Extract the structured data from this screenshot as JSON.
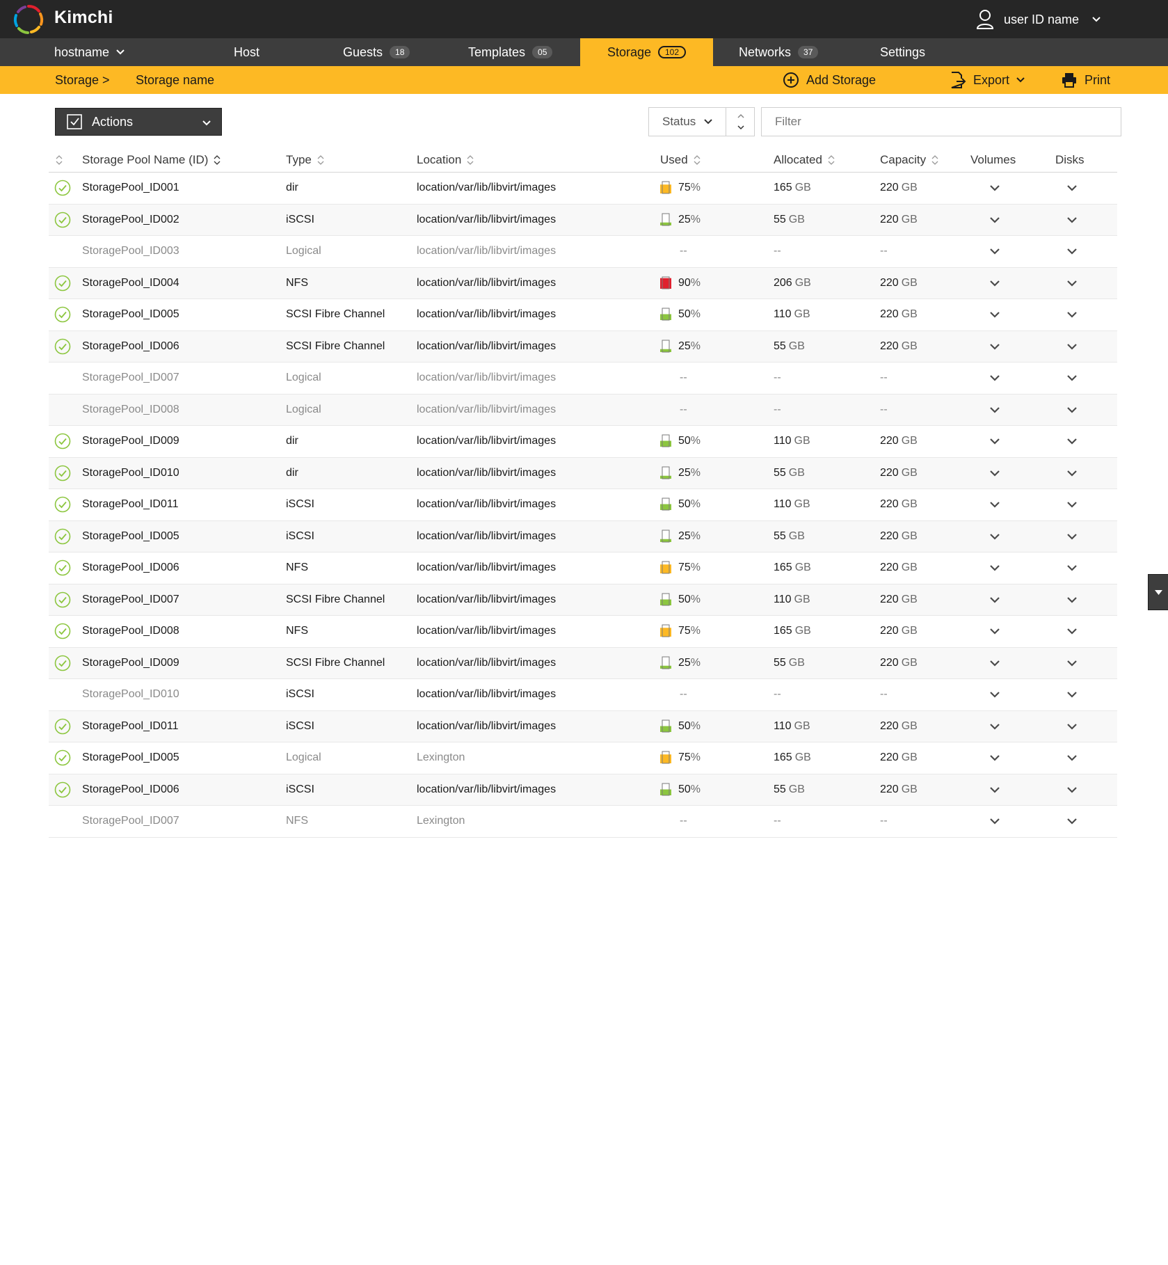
{
  "app": {
    "name": "Kimchi"
  },
  "user": {
    "name": "user ID name"
  },
  "nav": {
    "host_menu": "hostname",
    "items": [
      {
        "label": "Host",
        "badge": ""
      },
      {
        "label": "Guests",
        "badge": "18"
      },
      {
        "label": "Templates",
        "badge": "05"
      },
      {
        "label": "Storage",
        "badge": "102",
        "active": true
      },
      {
        "label": "Networks",
        "badge": "37"
      },
      {
        "label": "Settings",
        "badge": ""
      }
    ]
  },
  "breadcrumb": {
    "root": "Storage >",
    "current": "Storage name"
  },
  "toolbar": {
    "add": "Add Storage",
    "export": "Export",
    "print": "Print"
  },
  "controls": {
    "actions": "Actions",
    "status": "Status",
    "filter_placeholder": "Filter"
  },
  "table": {
    "columns": [
      "Storage Pool Name (ID)",
      "Type",
      "Location",
      "Used",
      "Allocated",
      "Capacity",
      "Volumes",
      "Disks"
    ],
    "rows": [
      {
        "name": "StoragePool_ID001",
        "type": "dir",
        "location": "location/var/lib/libvirt/images",
        "used": "75",
        "allocated": "165",
        "capacity": "220",
        "status": "active",
        "level": "warn"
      },
      {
        "name": "StoragePool_ID002",
        "type": "iSCSI",
        "location": "location/var/lib/libvirt/images",
        "used": "25",
        "allocated": "55",
        "capacity": "220",
        "status": "active",
        "level": "ok"
      },
      {
        "name": "StoragePool_ID003",
        "type": "Logical",
        "location": "location/var/lib/libvirt/images",
        "used": "--",
        "allocated": "--",
        "capacity": "--",
        "status": "inactive",
        "level": "none"
      },
      {
        "name": "StoragePool_ID004",
        "type": "NFS",
        "location": "location/var/lib/libvirt/images",
        "used": "90",
        "allocated": "206",
        "capacity": "220",
        "status": "active",
        "level": "critical"
      },
      {
        "name": "StoragePool_ID005",
        "type": "SCSI Fibre Channel",
        "location": "location/var/lib/libvirt/images",
        "used": "50",
        "allocated": "110",
        "capacity": "220",
        "status": "active",
        "level": "ok"
      },
      {
        "name": "StoragePool_ID006",
        "type": "SCSI Fibre Channel",
        "location": "location/var/lib/libvirt/images",
        "used": "25",
        "allocated": "55",
        "capacity": "220",
        "status": "active",
        "level": "ok"
      },
      {
        "name": "StoragePool_ID007",
        "type": "Logical",
        "location": "location/var/lib/libvirt/images",
        "used": "--",
        "allocated": "--",
        "capacity": "--",
        "status": "inactive",
        "level": "none"
      },
      {
        "name": "StoragePool_ID008",
        "type": "Logical",
        "location": "location/var/lib/libvirt/images",
        "used": "--",
        "allocated": "--",
        "capacity": "--",
        "status": "inactive",
        "level": "none"
      },
      {
        "name": "StoragePool_ID009",
        "type": "dir",
        "location": "location/var/lib/libvirt/images",
        "used": "50",
        "allocated": "110",
        "capacity": "220",
        "status": "active",
        "level": "ok"
      },
      {
        "name": "StoragePool_ID010",
        "type": "dir",
        "location": "location/var/lib/libvirt/images",
        "used": "25",
        "allocated": "55",
        "capacity": "220",
        "status": "active",
        "level": "ok"
      },
      {
        "name": "StoragePool_ID011",
        "type": "iSCSI",
        "location": "location/var/lib/libvirt/images",
        "used": "50",
        "allocated": "110",
        "capacity": "220",
        "status": "active",
        "level": "ok"
      },
      {
        "name": "StoragePool_ID005",
        "type": "iSCSI",
        "location": "location/var/lib/libvirt/images",
        "used": "25",
        "allocated": "55",
        "capacity": "220",
        "status": "active",
        "level": "ok"
      },
      {
        "name": "StoragePool_ID006",
        "type": "NFS",
        "location": "location/var/lib/libvirt/images",
        "used": "75",
        "allocated": "165",
        "capacity": "220",
        "status": "active",
        "level": "warn"
      },
      {
        "name": "StoragePool_ID007",
        "type": "SCSI Fibre Channel",
        "location": "location/var/lib/libvirt/images",
        "used": "50",
        "allocated": "110",
        "capacity": "220",
        "status": "active",
        "level": "ok"
      },
      {
        "name": "StoragePool_ID008",
        "type": "NFS",
        "location": "location/var/lib/libvirt/images",
        "used": "75",
        "allocated": "165",
        "capacity": "220",
        "status": "active",
        "level": "warn"
      },
      {
        "name": "StoragePool_ID009",
        "type": "SCSI Fibre Channel",
        "location": "location/var/lib/libvirt/images",
        "used": "25",
        "allocated": "55",
        "capacity": "220",
        "status": "active",
        "level": "ok"
      },
      {
        "name": "StoragePool_ID010",
        "type": "iSCSI",
        "location": "location/var/lib/libvirt/images",
        "used": "--",
        "allocated": "--",
        "capacity": "--",
        "status": "inactive",
        "level": "none"
      },
      {
        "name": "StoragePool_ID011",
        "type": "iSCSI",
        "location": "location/var/lib/libvirt/images",
        "used": "50",
        "allocated": "110",
        "capacity": "220",
        "status": "active",
        "level": "ok"
      },
      {
        "name": "StoragePool_ID005",
        "type": "Logical",
        "location": "Lexington",
        "used": "75",
        "allocated": "165",
        "capacity": "220",
        "status": "active",
        "level": "warn"
      },
      {
        "name": "StoragePool_ID006",
        "type": "iSCSI",
        "location": "location/var/lib/libvirt/images",
        "used": "50",
        "allocated": "55",
        "capacity": "220",
        "status": "active",
        "level": "ok"
      },
      {
        "name": "StoragePool_ID007",
        "type": "NFS",
        "location": "Lexington",
        "used": "--",
        "allocated": "--",
        "capacity": "--",
        "status": "inactive",
        "level": "none"
      }
    ],
    "units": {
      "percent": "%",
      "size": "GB"
    }
  },
  "colors": {
    "accent": "#fdb924",
    "topbar": "#262626",
    "nav": "#3d3d3d",
    "ok": "#8cc63f",
    "warn": "#fdb924",
    "critical": "#e0202e"
  },
  "icons": {
    "logo": "kimchi-logo-icon",
    "user": "user-icon",
    "add": "plus-circle-icon",
    "export": "export-icon",
    "print": "printer-icon",
    "status_active": "check-circle-icon",
    "gauge": "usage-gauge-icon",
    "expand": "chevron-down-icon",
    "sort": "sort-icon"
  }
}
